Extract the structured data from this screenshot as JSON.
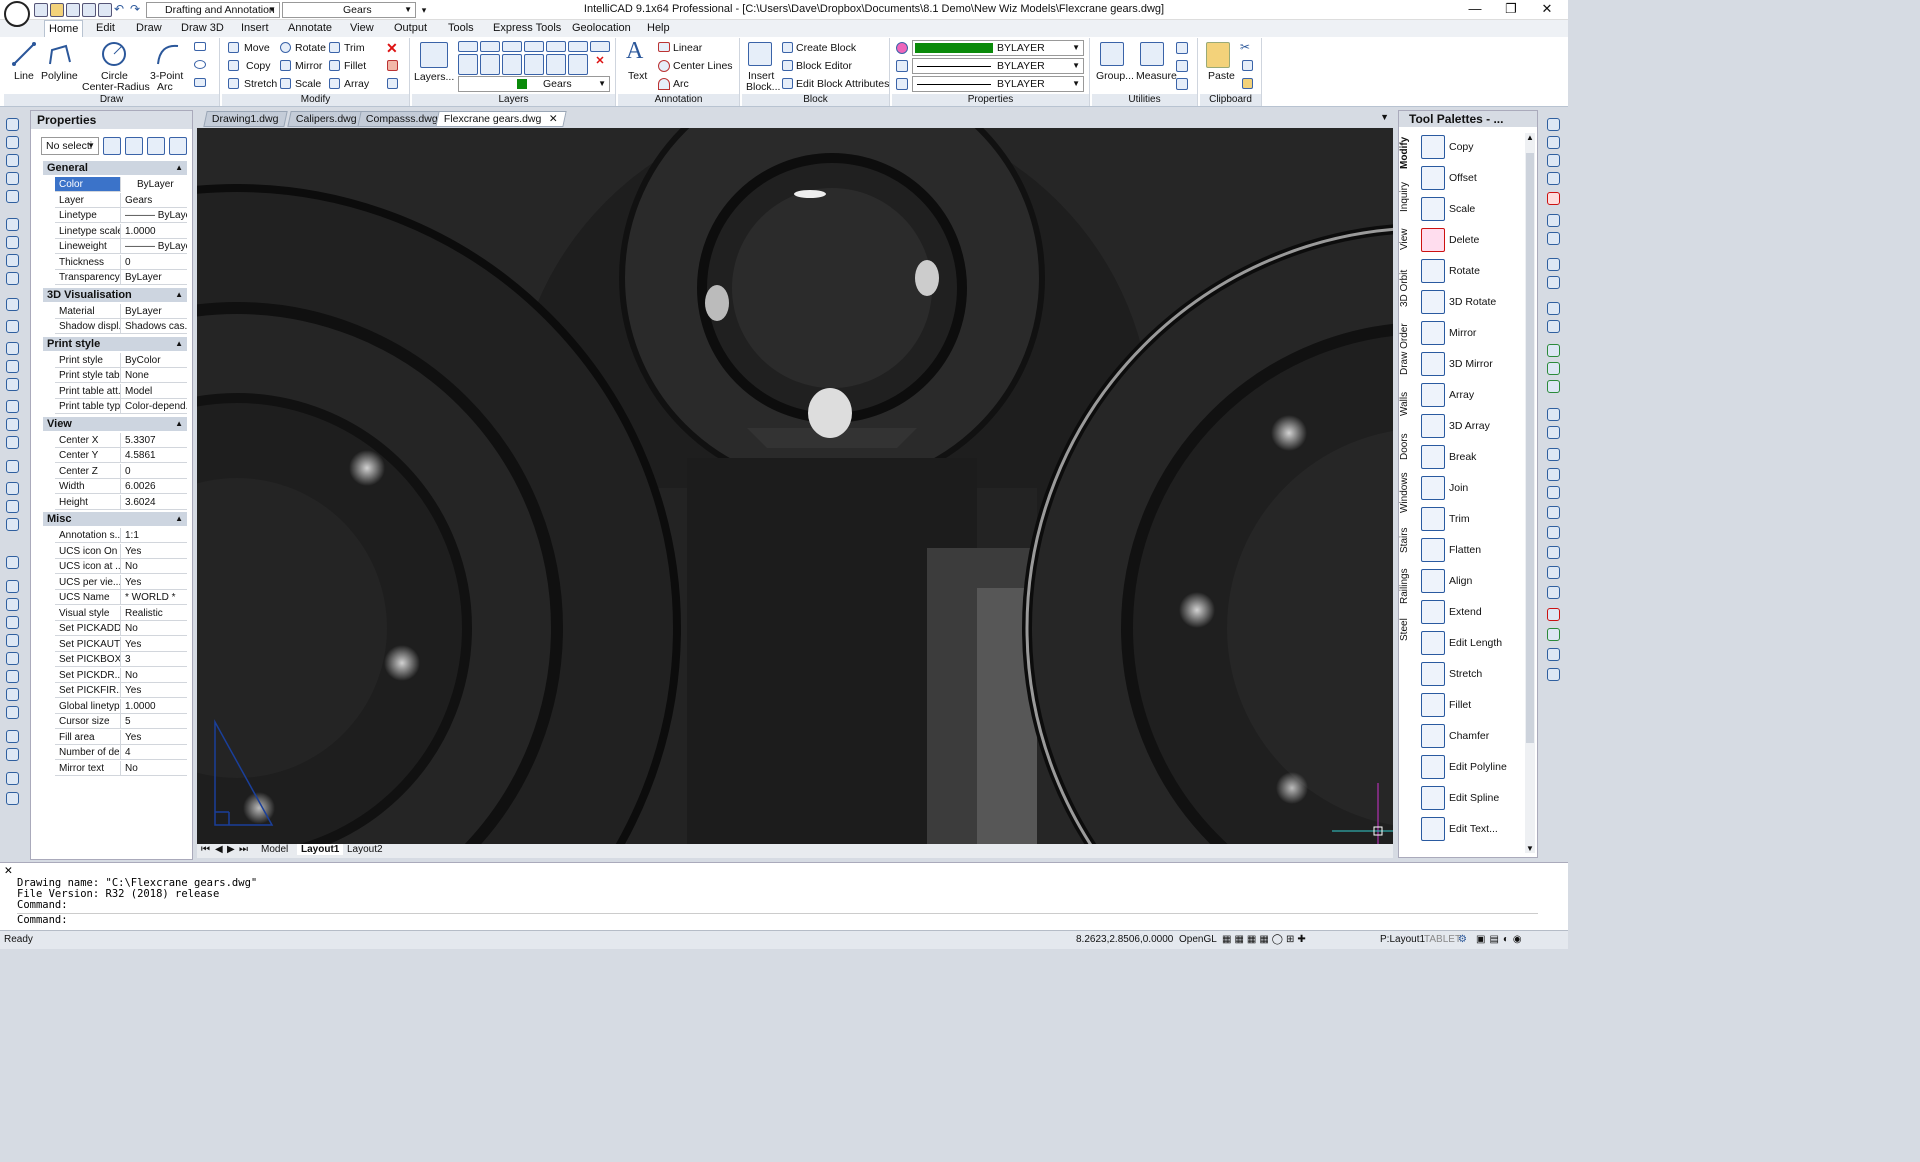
{
  "app": {
    "title": "IntelliCAD 9.1x64 Professional  - [C:\\Users\\Dave\\Dropbox\\Documents\\8.1 Demo\\New Wiz Models\\Flexcrane gears.dwg]",
    "workspace": "Drafting and Annotation",
    "layer_quick": "Gears",
    "win_min": "—",
    "win_max": "❐",
    "win_close": "✕"
  },
  "menu": [
    "Home",
    "Edit",
    "Draw",
    "Draw 3D",
    "Insert",
    "Annotate",
    "View",
    "Output",
    "Tools",
    "Express Tools",
    "Geolocation",
    "Help"
  ],
  "ribbon": {
    "draw": {
      "line": "Line",
      "polyline": "Polyline",
      "circle1": "Circle",
      "circle2": "Center-Radius",
      "arc1": "3-Point",
      "arc2": "Arc",
      "label": "Draw"
    },
    "modify": {
      "move": "Move",
      "rotate": "Rotate",
      "trim": "Trim",
      "copy": "Copy",
      "mirror": "Mirror",
      "fillet": "Fillet",
      "stretch": "Stretch",
      "scale": "Scale",
      "array": "Array",
      "label": "Modify"
    },
    "layers": {
      "layers_btn": "Layers...",
      "current": "Gears",
      "label": "Layers"
    },
    "annotation": {
      "text": "Text",
      "linear": "Linear",
      "centerlines": "Center Lines",
      "arc": "Arc",
      "label": "Annotation"
    },
    "block": {
      "insert1": "Insert",
      "insert2": "Block...",
      "create": "Create Block",
      "editor": "Block Editor",
      "editattr": "Edit Block Attributes",
      "label": "Block"
    },
    "properties": {
      "color": "BYLAYER",
      "linetype": "BYLAYER",
      "lineweight": "BYLAYER",
      "label": "Properties"
    },
    "utilities": {
      "group": "Group...",
      "measure": "Measure",
      "label": "Utilities"
    },
    "clipboard": {
      "paste": "Paste",
      "label": "Clipboard"
    }
  },
  "properties_panel": {
    "title": "Properties",
    "selection": "No selecti",
    "categories": [
      {
        "name": "General",
        "rows": [
          [
            "Color",
            "ByLayer"
          ],
          [
            "Layer",
            "Gears"
          ],
          [
            "Linetype",
            "——— ByLayer"
          ],
          [
            "Linetype scale",
            "1.0000"
          ],
          [
            "Lineweight",
            "——— ByLayer"
          ],
          [
            "Thickness",
            "0"
          ],
          [
            "Transparency",
            "ByLayer"
          ]
        ]
      },
      {
        "name": "3D Visualisation",
        "rows": [
          [
            "Material",
            "ByLayer"
          ],
          [
            "Shadow displ...",
            "Shadows cas..."
          ]
        ]
      },
      {
        "name": "Print style",
        "rows": [
          [
            "Print style",
            "ByColor"
          ],
          [
            "Print style table",
            "None"
          ],
          [
            "Print table att...",
            "Model"
          ],
          [
            "Print table type",
            "Color-depend..."
          ]
        ]
      },
      {
        "name": "View",
        "rows": [
          [
            "Center X",
            "5.3307"
          ],
          [
            "Center Y",
            "4.5861"
          ],
          [
            "Center Z",
            "0"
          ],
          [
            "Width",
            "6.0026"
          ],
          [
            "Height",
            "3.6024"
          ]
        ]
      },
      {
        "name": "Misc",
        "rows": [
          [
            "Annotation s...",
            "1:1"
          ],
          [
            "UCS icon On",
            "Yes"
          ],
          [
            "UCS icon at ...",
            "No"
          ],
          [
            "UCS per vie...",
            "Yes"
          ],
          [
            "UCS Name",
            "* WORLD *"
          ],
          [
            "Visual style",
            "Realistic"
          ],
          [
            "Set PICKADD",
            "No"
          ],
          [
            "Set PICKAUTO",
            "Yes"
          ],
          [
            "Set PICKBOX",
            "3"
          ],
          [
            "Set PICKDR...",
            "No"
          ],
          [
            "Set PICKFIR...",
            "Yes"
          ],
          [
            "Global linetyp...",
            "1.0000"
          ],
          [
            "Cursor size",
            "5"
          ],
          [
            "Fill area",
            "Yes"
          ],
          [
            "Number of de...",
            "4"
          ],
          [
            "Mirror text",
            "No"
          ]
        ]
      }
    ]
  },
  "doc_tabs": [
    "Drawing1.dwg",
    "Calipers.dwg",
    "Compasss.dwg",
    "Flexcrane gears.dwg"
  ],
  "layout_tabs": [
    "Model",
    "Layout1",
    "Layout2"
  ],
  "tool_palettes": {
    "title": "Tool Palettes - ...",
    "side_tabs": [
      "Modify",
      "Inquiry",
      "View",
      "3D Orbit",
      "Draw Order",
      "Walls",
      "Doors",
      "Windows",
      "Stairs",
      "Railings",
      "Steel"
    ],
    "items": [
      "Copy",
      "Offset",
      "Scale",
      "Delete",
      "Rotate",
      "3D Rotate",
      "Mirror",
      "3D Mirror",
      "Array",
      "3D Array",
      "Break",
      "Join",
      "Trim",
      "Flatten",
      "Align",
      "Extend",
      "Edit Length",
      "Stretch",
      "Fillet",
      "Chamfer",
      "Edit Polyline",
      "Edit Spline",
      "Edit Text..."
    ]
  },
  "command": {
    "lines": [
      "Drawing name: \"C:\\Flexcrane gears.dwg\"",
      "File Version: R32 (2018) release",
      "Command:",
      "Command:"
    ]
  },
  "status": {
    "ready": "Ready",
    "coords": "8.2623,2.8506,0.0000",
    "renderer": "OpenGL",
    "layout": "P:Layout1",
    "tablet": "TABLET"
  },
  "colors": {
    "accent": "#2b579a",
    "layer_green": "#0a8a0a",
    "viewport_bg": "#262626"
  }
}
